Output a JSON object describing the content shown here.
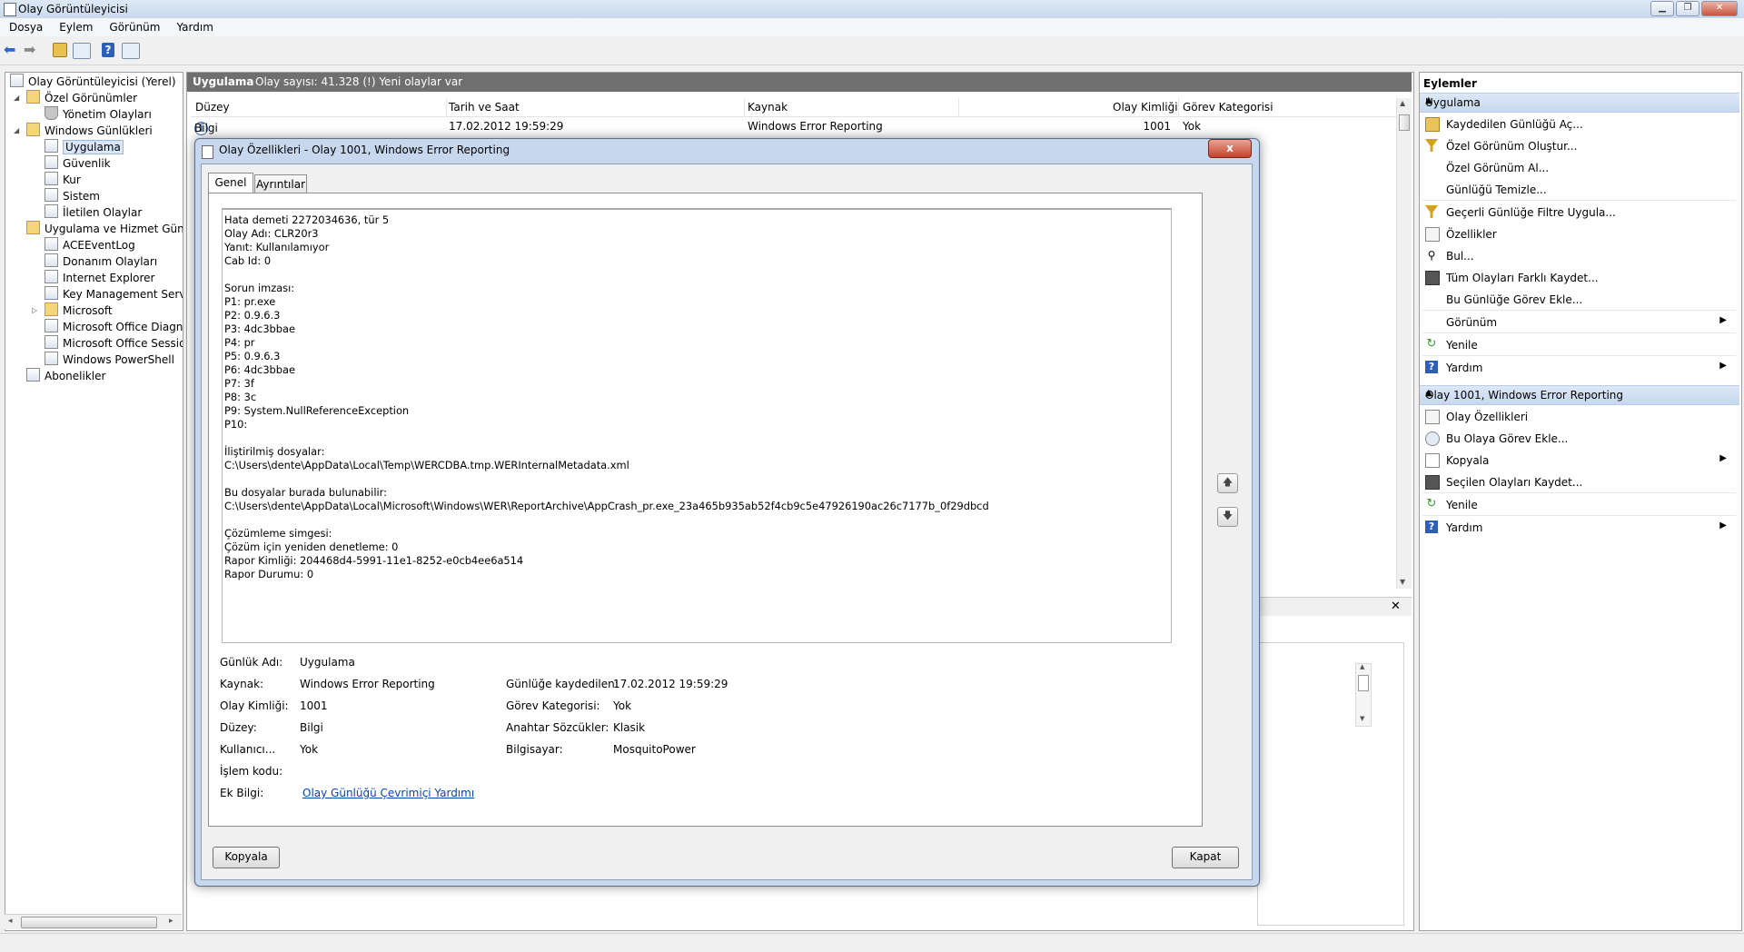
{
  "window": {
    "title": "Olay Görüntüleyicisi"
  },
  "menu": [
    "Dosya",
    "Eylem",
    "Görünüm",
    "Yardım"
  ],
  "tree": {
    "items": [
      {
        "label": "Olay Görüntüleyicisi (Yerel)"
      },
      {
        "label": "Özel Görünümler"
      },
      {
        "label": "Yönetim Olayları"
      },
      {
        "label": "Windows Günlükleri"
      },
      {
        "label": "Uygulama"
      },
      {
        "label": "Güvenlik"
      },
      {
        "label": "Kur"
      },
      {
        "label": "Sistem"
      },
      {
        "label": "İletilen Olaylar"
      },
      {
        "label": "Uygulama ve Hizmet Günlükl"
      },
      {
        "label": "ACEEventLog"
      },
      {
        "label": "Donanım Olayları"
      },
      {
        "label": "Internet Explorer"
      },
      {
        "label": "Key Management Service"
      },
      {
        "label": "Microsoft"
      },
      {
        "label": "Microsoft Office Diagnos"
      },
      {
        "label": "Microsoft Office Sessions"
      },
      {
        "label": "Windows PowerShell"
      },
      {
        "label": "Abonelikler"
      }
    ]
  },
  "center": {
    "title": "Uygulama",
    "count": "Olay sayısı: 41.328 (!) Yeni olaylar var",
    "columns": [
      "Düzey",
      "Tarih ve Saat",
      "Kaynak",
      "Olay Kimliği",
      "Görev Kategorisi"
    ],
    "rows": [
      {
        "level": "Bilgi",
        "date": "17.02.2012 19:59:29",
        "source": "Windows Error Reporting",
        "id": "1001",
        "category": "Yok"
      }
    ]
  },
  "actions": {
    "header": "Eylemler",
    "sections": [
      {
        "title": "Uygulama",
        "items": [
          {
            "label": "Kaydedilen Günlüğü Aç...",
            "icon": "open-log-icon"
          },
          {
            "label": "Özel Görünüm Oluştur...",
            "icon": "filter-icon"
          },
          {
            "label": "Özel Görünüm Al...",
            "icon": ""
          },
          {
            "label": "Günlüğü Temizle...",
            "icon": ""
          },
          {
            "label": "Geçerli Günlüğe Filtre Uygula...",
            "icon": "filter-icon"
          },
          {
            "label": "Özellikler",
            "icon": "properties-icon"
          },
          {
            "label": "Bul...",
            "icon": "find-icon"
          },
          {
            "label": "Tüm Olayları Farklı Kaydet...",
            "icon": "save-icon"
          },
          {
            "label": "Bu Günlüğe Görev Ekle...",
            "icon": ""
          },
          {
            "label": "Görünüm",
            "icon": ""
          },
          {
            "label": "Yenile",
            "icon": "refresh-icon"
          },
          {
            "label": "Yardım",
            "icon": "help-icon"
          }
        ]
      },
      {
        "title": "Olay 1001, Windows Error Reporting",
        "items": [
          {
            "label": "Olay Özellikleri",
            "icon": "properties-icon"
          },
          {
            "label": "Bu Olaya Görev Ekle...",
            "icon": "task-icon"
          },
          {
            "label": "Kopyala",
            "icon": "copy-icon"
          },
          {
            "label": "Seçilen Olayları Kaydet...",
            "icon": "save-icon"
          },
          {
            "label": "Yenile",
            "icon": "refresh-icon"
          },
          {
            "label": "Yardım",
            "icon": "help-icon"
          }
        ]
      }
    ]
  },
  "dialog": {
    "title": "Olay Özellikleri - Olay 1001, Windows Error Reporting",
    "close": "x",
    "tabs": [
      "Genel",
      "Ayrıntılar"
    ],
    "description": "Hata demeti 2272034636, tür 5\nOlay Adı: CLR20r3\nYanıt: Kullanılamıyor\nCab Id: 0\n\nSorun imzası:\nP1: pr.exe\nP2: 0.9.6.3\nP3: 4dc3bbae\nP4: pr\nP5: 0.9.6.3\nP6: 4dc3bbae\nP7: 3f\nP8: 3c\nP9: System.NullReferenceException\nP10:\n\nİliştirilmiş dosyalar:\nC:\\Users\\dente\\AppData\\Local\\Temp\\WERCDBA.tmp.WERInternalMetadata.xml\n\nBu dosyalar burada bulunabilir:\nC:\\Users\\dente\\AppData\\Local\\Microsoft\\Windows\\WER\\ReportArchive\\AppCrash_pr.exe_23a465b935ab52f4cb9c5e47926190ac26c7177b_0f29dbcd\n\nÇözümleme simgesi:\nÇözüm için yeniden denetleme: 0\nRapor Kimliği: 204468d4-5991-11e1-8252-e0cb4ee6a514\nRapor Durumu: 0",
    "fields": {
      "log_name_label": "Günlük Adı:",
      "log_name": "Uygulama",
      "source_label": "Kaynak:",
      "source": "Windows Error Reporting",
      "logged_label": "Günlüğe kaydedilen:",
      "logged": "17.02.2012 19:59:29",
      "event_id_label": "Olay Kimliği:",
      "event_id": "1001",
      "task_label": "Görev Kategorisi:",
      "task": "Yok",
      "level_label": "Düzey:",
      "level": "Bilgi",
      "keywords_label": "Anahtar Sözcükler:",
      "keywords": "Klasik",
      "user_label": "Kullanıcı...",
      "user": "Yok",
      "computer_label": "Bilgisayar:",
      "computer": "MosquitoPower",
      "opcode_label": "İşlem kodu:",
      "more_info_label": "Ek Bilgi:",
      "more_info_link": "Olay Günlüğü Çevrimiçi Yardımı"
    },
    "buttons": {
      "copy": "Kopyala",
      "close": "Kapat"
    }
  },
  "detail_pane": {
    "close": "✕"
  },
  "colors": {
    "section_bar": "#c6d8ef",
    "center_header": "#6f6f6f",
    "link": "#0645ad"
  }
}
